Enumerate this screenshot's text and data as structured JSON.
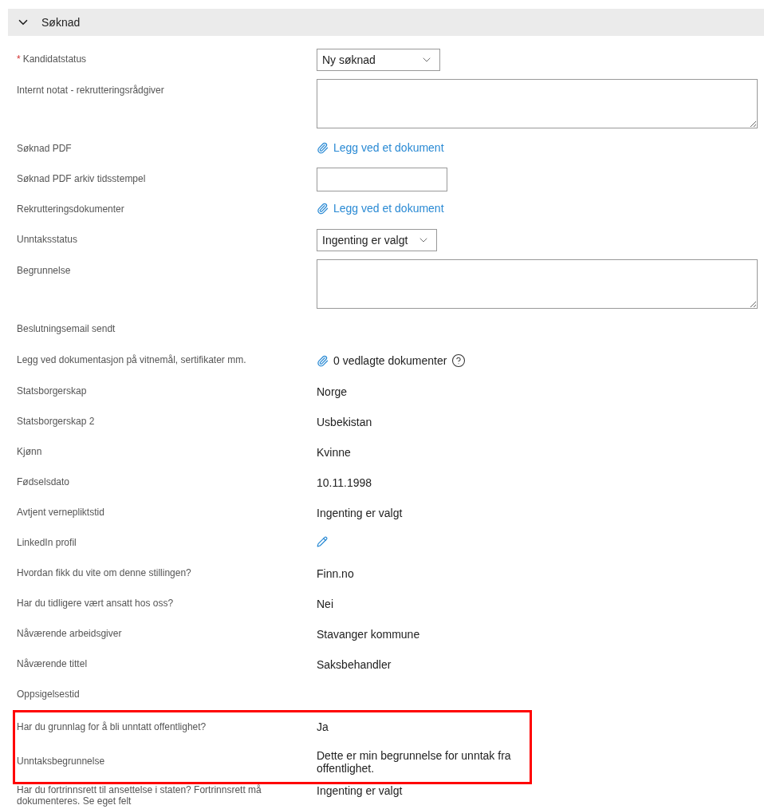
{
  "section": {
    "title": "Søknad",
    "expanded": true
  },
  "required_symbol": "*",
  "rows": [
    {
      "label": "Kandidatstatus",
      "required": true,
      "kind": "select",
      "value": "Ny søknad",
      "highlighted": false
    },
    {
      "label": "Internt notat - rekrutteringsrådgiver",
      "required": false,
      "kind": "textarea",
      "highlighted": false
    },
    {
      "label": "Søknad PDF",
      "required": false,
      "kind": "attach",
      "value": "Legg ved et dokument",
      "highlighted": false
    },
    {
      "label": "Søknad PDF arkiv tidsstempel",
      "required": false,
      "kind": "input",
      "highlighted": false
    },
    {
      "label": "Rekrutteringsdokumenter",
      "required": false,
      "kind": "attach",
      "value": "Legg ved et dokument",
      "highlighted": false
    },
    {
      "label": "Unntaksstatus",
      "required": false,
      "kind": "select",
      "value": "Ingenting er valgt",
      "highlighted": false
    },
    {
      "label": "Begrunnelse",
      "required": false,
      "kind": "textarea",
      "highlighted": false
    },
    {
      "label": "Beslutningsemail sendt",
      "required": false,
      "kind": "text",
      "highlighted": false
    },
    {
      "label": "Legg ved dokumentasjon på vitnemål, sertifikater mm.",
      "required": false,
      "kind": "count",
      "value": "0 vedlagte dokumenter",
      "highlighted": false
    },
    {
      "label": "Statsborgerskap",
      "required": false,
      "kind": "text",
      "value": "Norge",
      "highlighted": false
    },
    {
      "label": "Statsborgerskap 2",
      "required": false,
      "kind": "text",
      "value": "Usbekistan",
      "highlighted": false
    },
    {
      "label": "Kjønn",
      "required": false,
      "kind": "text",
      "value": "Kvinne",
      "highlighted": false
    },
    {
      "label": "Fødselsdato",
      "required": false,
      "kind": "text",
      "value": "10.11.1998",
      "highlighted": false
    },
    {
      "label": "Avtjent vernepliktstid",
      "required": false,
      "kind": "text",
      "value": "Ingenting er valgt",
      "highlighted": false
    },
    {
      "label": "LinkedIn profil",
      "required": false,
      "kind": "edit",
      "highlighted": false
    },
    {
      "label": "Hvordan fikk du vite om denne stillingen?",
      "required": false,
      "kind": "text",
      "value": "Finn.no",
      "highlighted": false
    },
    {
      "label": "Har du tidligere vært ansatt hos oss?",
      "required": false,
      "kind": "text",
      "value": "Nei",
      "highlighted": false
    },
    {
      "label": "Nåværende arbeidsgiver",
      "required": false,
      "kind": "text",
      "value": "Stavanger kommune",
      "highlighted": false
    },
    {
      "label": "Nåværende tittel",
      "required": false,
      "kind": "text",
      "value": "Saksbehandler",
      "highlighted": false
    },
    {
      "label": "Oppsigelsestid",
      "required": false,
      "kind": "text",
      "highlighted": false
    },
    {
      "label": "Har du grunnlag for å bli unntatt offentlighet?",
      "required": false,
      "kind": "text",
      "value": "Ja",
      "highlighted": true
    },
    {
      "label": "Unntaksbegrunnelse",
      "required": false,
      "kind": "text",
      "value": "Dette er min begrunnelse for unntak fra offentlighet.",
      "highlighted": true
    },
    {
      "label": "Har du fortrinnsrett til ansettelse i staten? Fortrinnsrett må dokumenteres. Se eget felt",
      "required": false,
      "kind": "text",
      "value": "Ingenting er valgt",
      "highlighted": false
    }
  ]
}
